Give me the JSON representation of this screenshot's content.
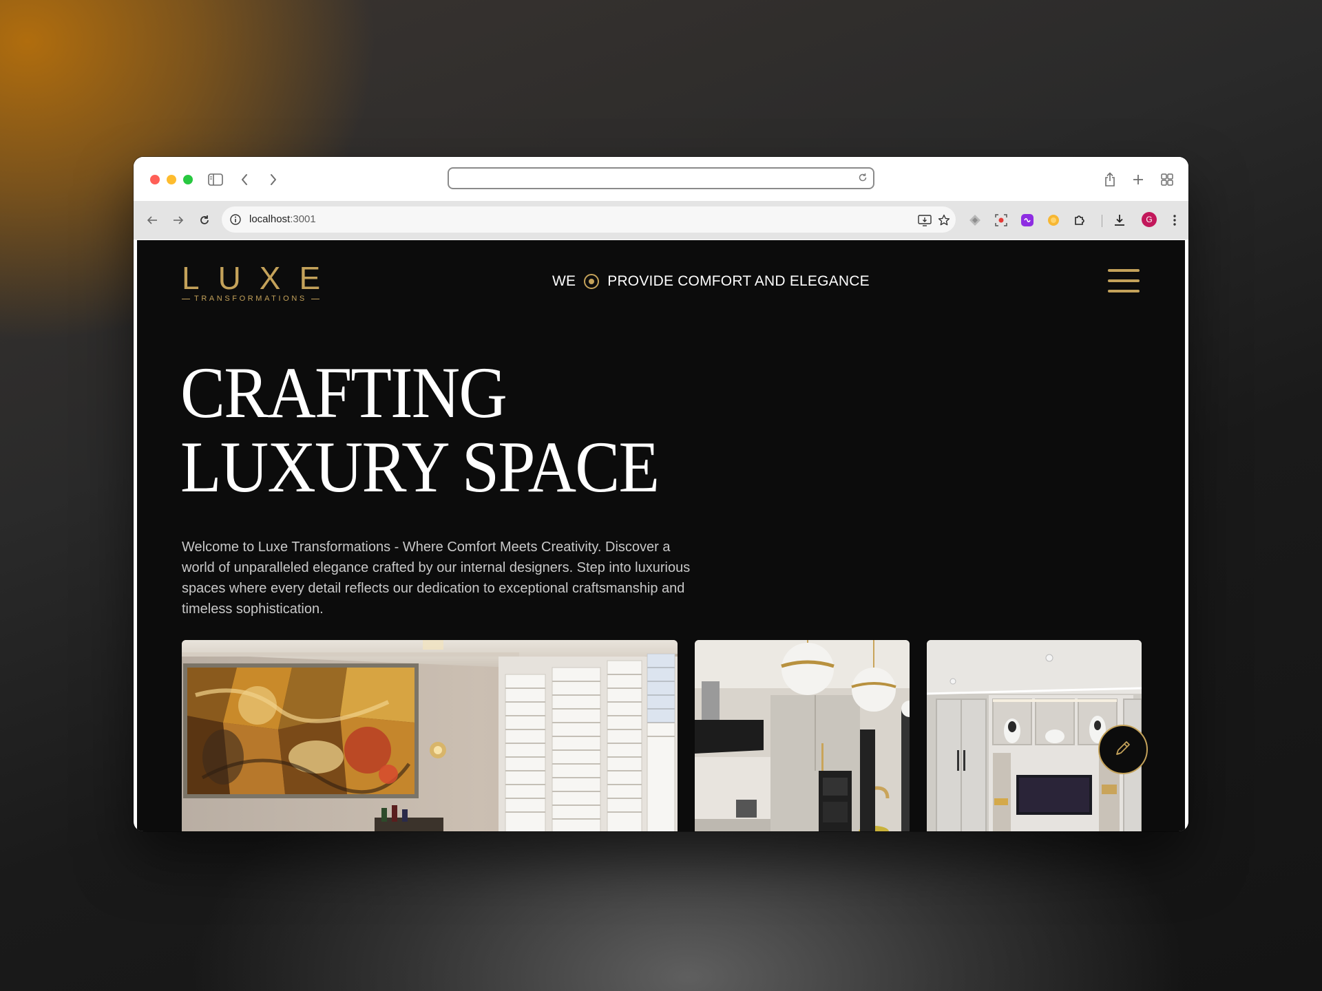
{
  "browser": {
    "safari_url_value": "",
    "chrome_url_host": "localhost",
    "chrome_url_port": ":3001",
    "profile_initial": "G"
  },
  "brand": {
    "logo_word": "LUXE",
    "logo_sub": "TRANSFORMATIONS"
  },
  "header": {
    "tagline_left": "WE",
    "tagline_right": "PROVIDE COMFORT AND ELEGANCE",
    "menu_icon": "hamburger-icon"
  },
  "hero": {
    "title_line1": "CRAFTING",
    "title_line2": "LUXURY SPACE",
    "description": "Welcome to Luxe Transformations - Where Comfort Meets Creativity. Discover a world of unparalleled elegance crafted by our internal designers. Step into luxurious spaces where every detail reflects our dedication to exceptional craftsmanship and timeless sophistication."
  },
  "gallery": [
    {
      "name": "living-room-mural"
    },
    {
      "name": "kitchen-pendants"
    },
    {
      "name": "media-wall-cabinets"
    }
  ],
  "colors": {
    "accent_gold": "#c4a25a",
    "page_bg": "#0c0c0c",
    "text_white": "#ffffff",
    "text_muted": "#c9c9c9"
  },
  "fab": {
    "icon": "pencil-icon"
  }
}
